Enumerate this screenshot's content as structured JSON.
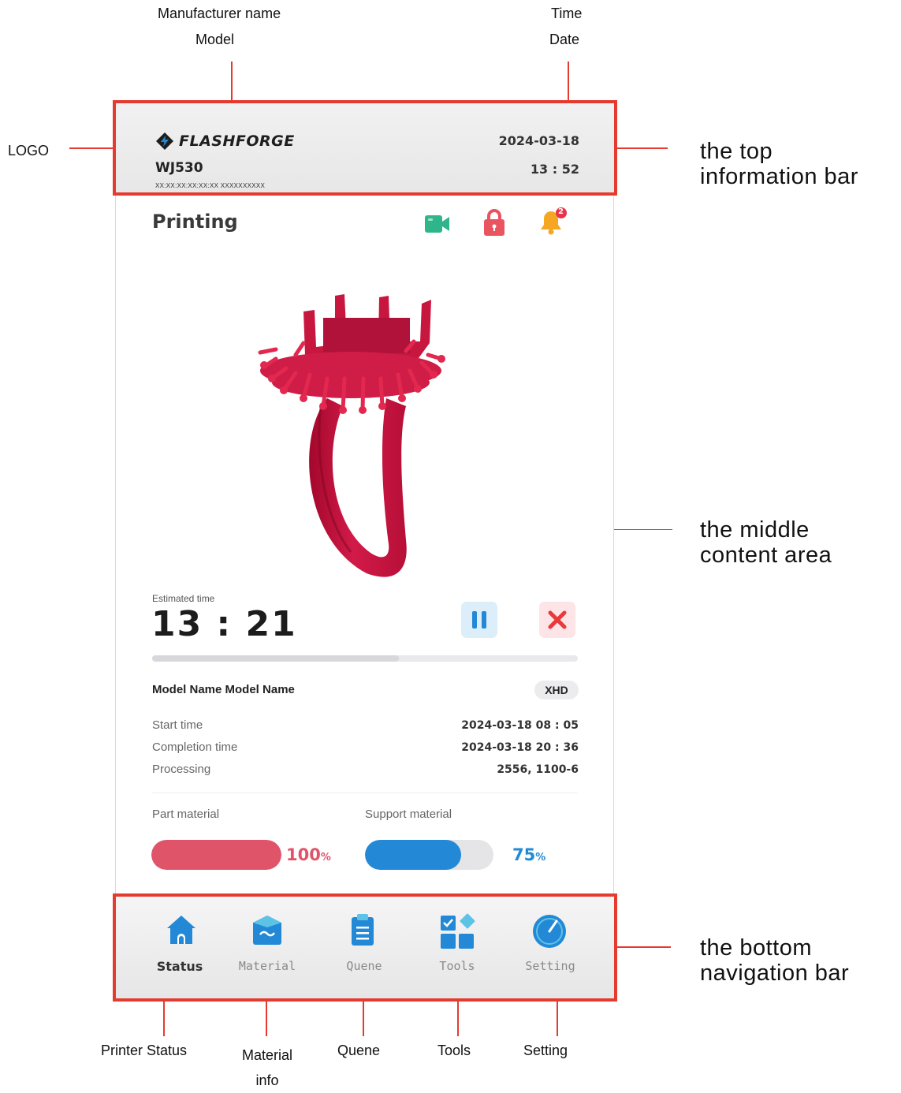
{
  "annotations": {
    "manufacturer_name": "Manufacturer name",
    "model": "Model",
    "time": "Time",
    "date": "Date",
    "logo": "LOGO",
    "top_bar": [
      "the top",
      "information bar"
    ],
    "middle_area": [
      "the middle",
      "content area"
    ],
    "bottom_bar": [
      "the bottom",
      "navigation bar"
    ],
    "printer_status": "Printer Status",
    "material_info": [
      "Material",
      "info"
    ],
    "quene": "Quene",
    "tools": "Tools",
    "setting": "Setting"
  },
  "topbar": {
    "brand": "FLASHFORGE",
    "model": "WJ530",
    "serial": "XX:XX:XX:XX:XX:XX   XXXXXXXXXX",
    "date": "2024-03-18",
    "time": "13 : 52"
  },
  "status": {
    "title": "Printing",
    "icons": [
      "camera-icon",
      "lock-icon",
      "bell-icon"
    ],
    "notification_count": "2"
  },
  "job": {
    "estimated_label": "Estimated time",
    "estimated_value": "13 : 21",
    "progress_fraction": 0.58,
    "name": "Model Name Model Name",
    "quality_badge": "XHD",
    "rows": [
      {
        "label": "Start time",
        "value": "2024-03-18  08 : 05"
      },
      {
        "label": "Completion time",
        "value": "2024-03-18  20 : 36"
      },
      {
        "label": "Processing",
        "value": "2556,  1100-6"
      }
    ]
  },
  "materials": {
    "part": {
      "label": "Part material",
      "percent": "100",
      "level": 1.0,
      "color": "#e0546a"
    },
    "support": {
      "label": "Support material",
      "percent": "75",
      "level": 0.75,
      "color": "#2389d6"
    },
    "unit": "%"
  },
  "nav": {
    "items": [
      {
        "label": "Status",
        "icon": "home-icon",
        "active": true
      },
      {
        "label": "Material",
        "icon": "material-icon",
        "active": false
      },
      {
        "label": "Quene",
        "icon": "clipboard-icon",
        "active": false
      },
      {
        "label": "Tools",
        "icon": "tools-icon",
        "active": false
      },
      {
        "label": "Setting",
        "icon": "gauge-icon",
        "active": false
      }
    ]
  },
  "colors": {
    "annotation_red": "#e53b2f",
    "accent_blue": "#2389d6",
    "model_red": "#c8173f",
    "camera_green": "#2fb58a",
    "lock_red": "#ea5360",
    "bell_orange": "#f5a623"
  }
}
